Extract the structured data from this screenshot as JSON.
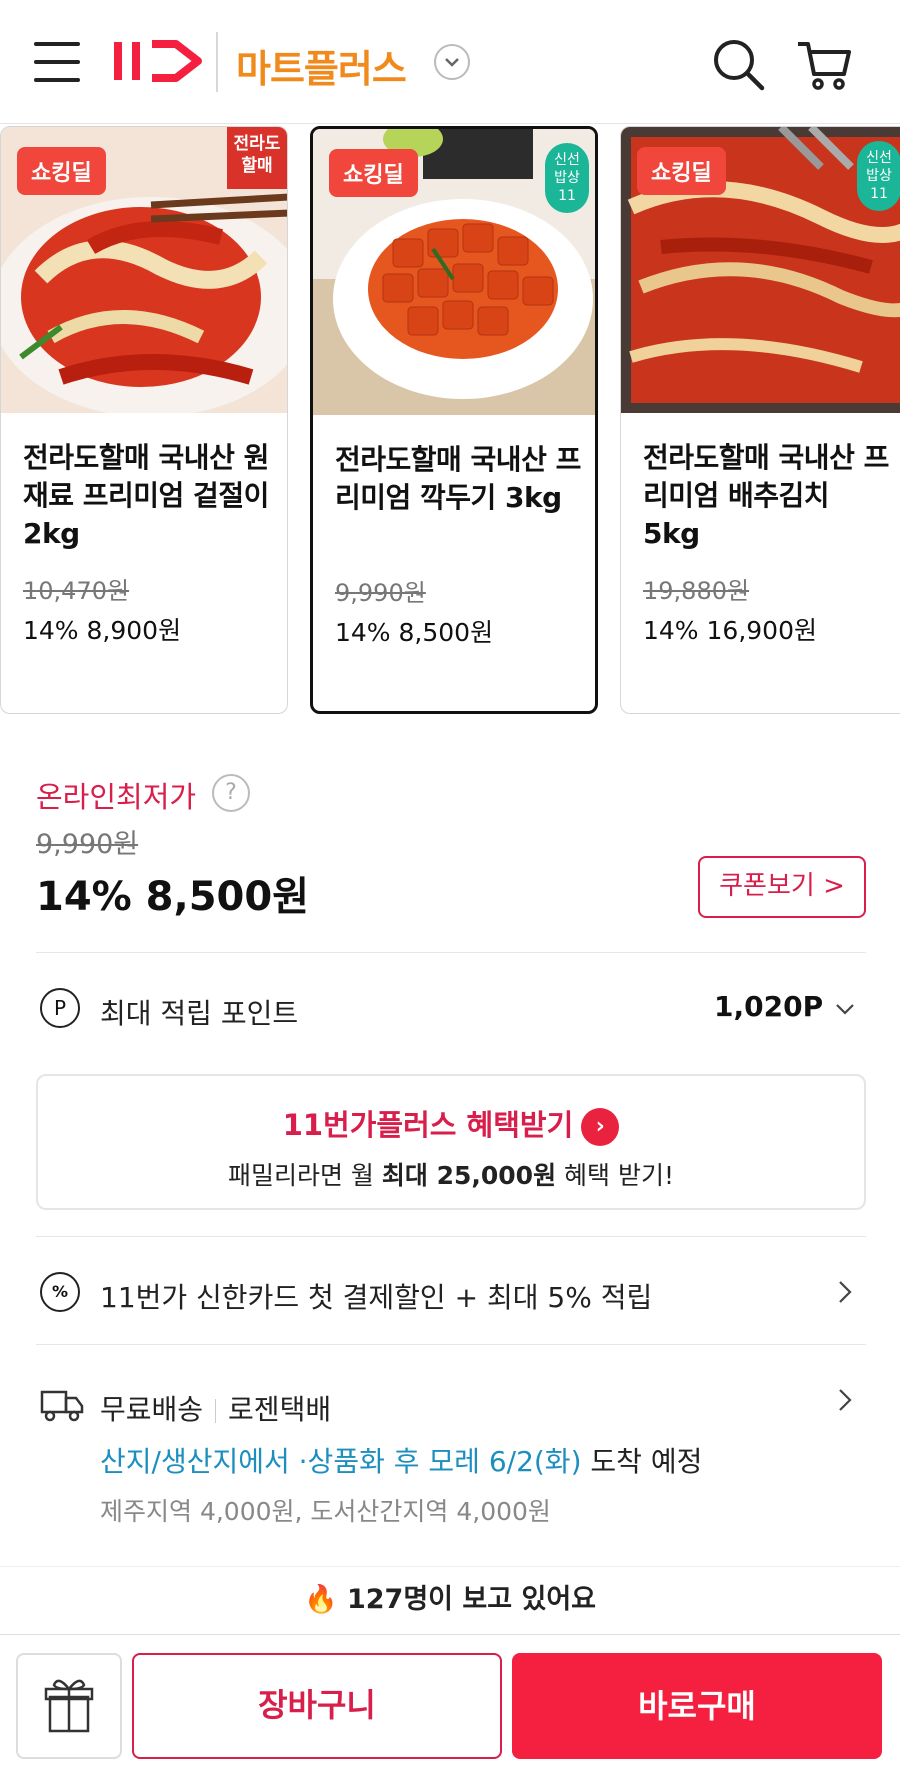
{
  "header": {
    "logo": "11",
    "brand": "마트플러스"
  },
  "products": [
    {
      "deal_badge": "쇼킹딜",
      "corner_badge": "전라도 할매",
      "name": "전라도할매 국내산 원재료 프리미엄 겉절이 2kg",
      "original_price": "10,470원",
      "sale_price": "14% 8,900원"
    },
    {
      "deal_badge": "쇼킹딜",
      "corner_badge": "신선 밥상 11",
      "name": "전라도할매 국내산 프리미엄 깍두기 3kg",
      "original_price": "9,990원",
      "sale_price": "14% 8,500원"
    },
    {
      "deal_badge": "쇼킹딜",
      "corner_badge": "신선 밥상 11",
      "name": "전라도할매 국내산 프리미엄 배추김치 5kg",
      "original_price": "19,880원",
      "sale_price": "14% 16,900원"
    }
  ],
  "price": {
    "lowest_label": "온라인최저가",
    "help": "?",
    "original": "9,990원",
    "final": "14% 8,500원",
    "coupon_button": "쿠폰보기 >"
  },
  "points": {
    "icon_letter": "P",
    "label": "최대 적립 포인트",
    "value": "1,020P"
  },
  "benefit": {
    "title": "11번가플러스 혜택받기",
    "sub_prefix": "패밀리라면 월 ",
    "sub_bold": "최대 25,000원",
    "sub_suffix": " 혜택 받기!"
  },
  "card_promo": {
    "icon_text": "%",
    "text": "11번가 신한카드 첫 결제할인 + 최대 5% 적립"
  },
  "shipping": {
    "free": "무료배송",
    "courier": "로젠택배",
    "arrival_highlight": "산지/생산지에서 ·상품화 후 모레 6/2(화)",
    "arrival_suffix": " 도착 예정",
    "extra_fee": "제주지역 4,000원, 도서산간지역 4,000원"
  },
  "viewers": "🔥 127명이 보고 있어요",
  "bottom": {
    "cart": "장바구니",
    "buy": "바로구매"
  }
}
